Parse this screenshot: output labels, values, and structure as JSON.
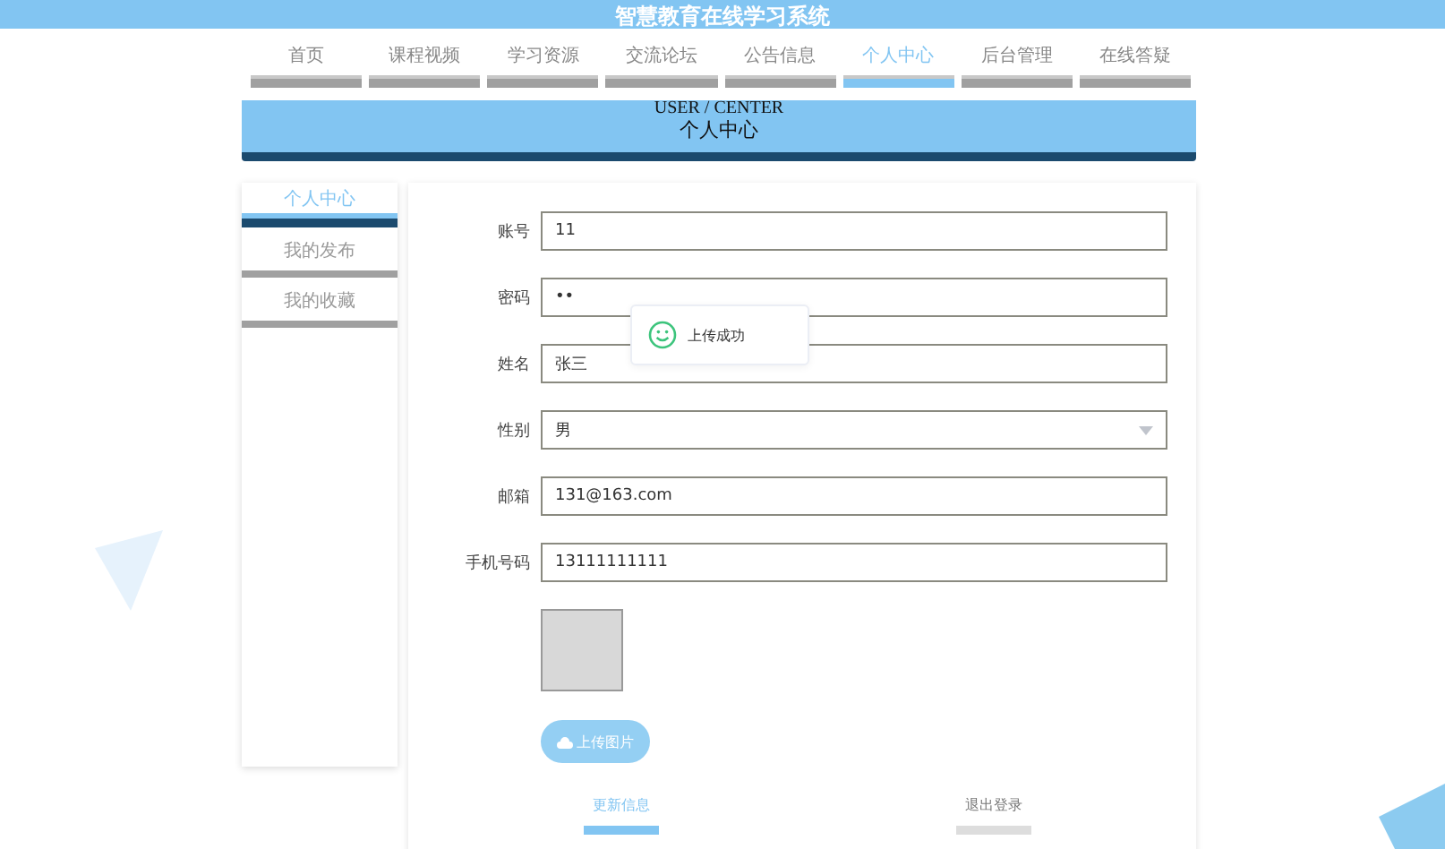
{
  "header": {
    "title": "智慧教育在线学习系统"
  },
  "nav": [
    {
      "label": "首页",
      "selected": false
    },
    {
      "label": "课程视频",
      "selected": false
    },
    {
      "label": "学习资源",
      "selected": false
    },
    {
      "label": "交流论坛",
      "selected": false
    },
    {
      "label": "公告信息",
      "selected": false
    },
    {
      "label": "个人中心",
      "selected": true
    },
    {
      "label": "后台管理",
      "selected": false
    },
    {
      "label": "在线答疑",
      "selected": false
    }
  ],
  "banner": {
    "subtitle": "USER / CENTER",
    "title": "个人中心"
  },
  "sidebar": {
    "items": [
      {
        "label": "个人中心",
        "selected": true
      },
      {
        "label": "我的发布",
        "selected": false
      },
      {
        "label": "我的收藏",
        "selected": false
      }
    ]
  },
  "form": {
    "fields": [
      {
        "label": "账号",
        "kind": "text",
        "value": "11"
      },
      {
        "label": "密码",
        "kind": "text",
        "value": "••"
      },
      {
        "label": "姓名",
        "kind": "text",
        "value": "张三"
      },
      {
        "label": "性别",
        "kind": "select",
        "value": "男"
      },
      {
        "label": "邮箱",
        "kind": "text",
        "value": "131@163.com"
      },
      {
        "label": "手机号码",
        "kind": "text",
        "value": "13111111111"
      }
    ],
    "upload_button": "上传图片",
    "actions": [
      {
        "label": "更新信息",
        "kind": "primary"
      },
      {
        "label": "退出登录",
        "kind": "default"
      }
    ]
  },
  "toast": {
    "message": "上传成功"
  }
}
